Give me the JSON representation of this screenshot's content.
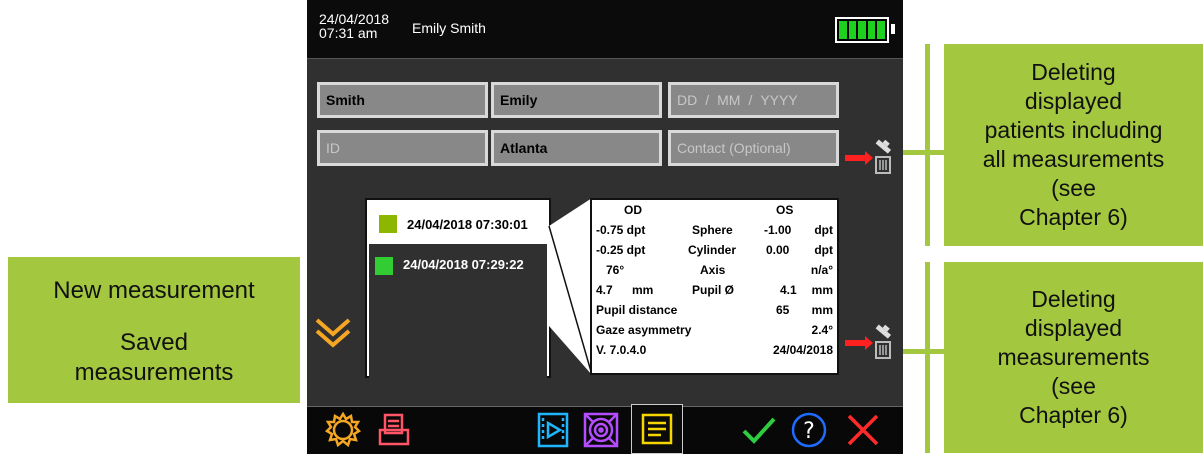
{
  "header": {
    "date": "24/04/2018",
    "time": "07:31 am",
    "patient_name": "Emily Smith",
    "battery": "full"
  },
  "form": {
    "last_name": "Smith",
    "first_name": "Emily",
    "dob_dd": "DD",
    "dob_mm": "MM",
    "dob_yyyy": "YYYY",
    "dob_sep": "/",
    "id_placeholder": "ID",
    "city": "Atlanta",
    "contact_placeholder": "Contact (Optional)"
  },
  "measurements": {
    "new": {
      "label": "24/04/2018 07:30:01",
      "color": "#8db600"
    },
    "saved": [
      {
        "label": "24/04/2018 07:29:22",
        "color": "#32cd32"
      }
    ]
  },
  "details": {
    "od": "OD",
    "os": "OS",
    "sphere": {
      "label": "Sphere",
      "od": "-0.75 dpt",
      "os_val": "-1.00",
      "os_unit": "dpt"
    },
    "cylinder": {
      "label": "Cylinder",
      "od": "-0.25 dpt",
      "os_val": "0.00",
      "os_unit": "dpt"
    },
    "axis": {
      "label": "Axis",
      "od": "76°",
      "os": "n/a°"
    },
    "pupil": {
      "label": "Pupil Ø",
      "od_val": "4.7",
      "od_unit": "mm",
      "os_val": "4.1",
      "os_unit": "mm"
    },
    "pupil_distance": {
      "label": "Pupil distance",
      "value": "65",
      "unit": "mm"
    },
    "gaze": {
      "label": "Gaze asymmetry",
      "value": "2.4°"
    },
    "version": "V. 7.0.4.0",
    "date": "24/04/2018"
  },
  "callouts": {
    "new_measurement": "New measurement",
    "saved_measurements": "Saved\nmeasurements",
    "delete_patients": "Deleting\ndisplayed\npatients including\nall measurements\n(see\nChapter 6)",
    "delete_measurements": "Deleting\ndisplayed\nmeasurements\n(see\nChapter 6)"
  },
  "toolbar": [
    "settings-icon",
    "print-icon",
    "video-icon",
    "target-icon",
    "report-icon",
    "confirm-icon",
    "help-icon",
    "cancel-icon"
  ],
  "colors": {
    "callout": "#a3c73e",
    "accent_orange": "#f5a623",
    "green": "#2ecc40",
    "red": "#ff2b2b"
  }
}
